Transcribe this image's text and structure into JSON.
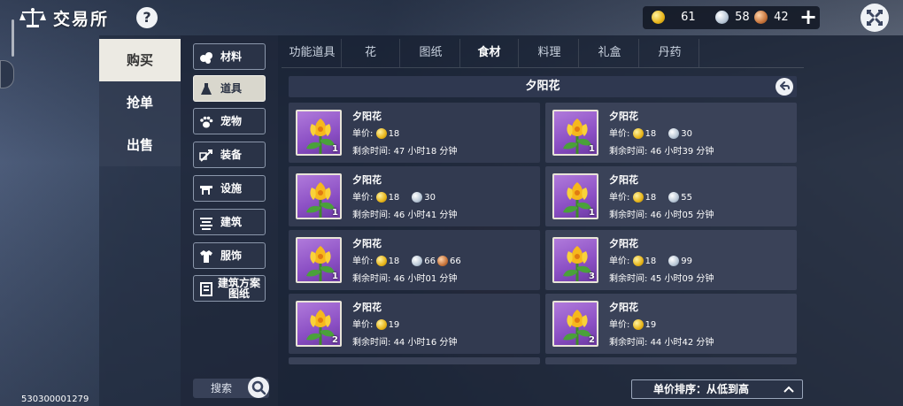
{
  "header": {
    "title": "交易所",
    "help_label": "?"
  },
  "currency": {
    "gold": "61",
    "silver": "58",
    "bronze": "42",
    "add_label": "+"
  },
  "main_tabs": [
    "购买",
    "抢单",
    "出售"
  ],
  "categories": [
    "材料",
    "道具",
    "宠物",
    "装备",
    "设施",
    "建筑",
    "服饰",
    "建筑方案图纸"
  ],
  "search": {
    "label": "搜索"
  },
  "subtabs": [
    "功能道具",
    "花",
    "图纸",
    "食材",
    "料理",
    "礼盒",
    "丹药"
  ],
  "item_header": "夕阳花",
  "listing_labels": {
    "price": "单价:",
    "time": "剩余时间:"
  },
  "listings": [
    {
      "name": "夕阳花",
      "qty": "1",
      "gold": "18",
      "silver": "",
      "bronze": "",
      "time": "47 小时18 分钟"
    },
    {
      "name": "夕阳花",
      "qty": "1",
      "gold": "18",
      "silver": "30",
      "bronze": "",
      "time": "46 小时39 分钟"
    },
    {
      "name": "夕阳花",
      "qty": "1",
      "gold": "18",
      "silver": "30",
      "bronze": "",
      "time": "46 小时41 分钟"
    },
    {
      "name": "夕阳花",
      "qty": "1",
      "gold": "18",
      "silver": "55",
      "bronze": "",
      "time": "46 小时05 分钟"
    },
    {
      "name": "夕阳花",
      "qty": "1",
      "gold": "18",
      "silver": "66",
      "bronze": "66",
      "time": "46 小时01 分钟"
    },
    {
      "name": "夕阳花",
      "qty": "3",
      "gold": "18",
      "silver": "99",
      "bronze": "",
      "time": "45 小时09 分钟"
    },
    {
      "name": "夕阳花",
      "qty": "2",
      "gold": "19",
      "silver": "",
      "bronze": "",
      "time": "44 小时16 分钟"
    },
    {
      "name": "夕阳花",
      "qty": "2",
      "gold": "19",
      "silver": "",
      "bronze": "",
      "time": "44 小时42 分钟"
    }
  ],
  "sort": {
    "label": "单价排序：从低到高"
  },
  "uid": "530300001279",
  "colors": {
    "gold": "#e7b51a",
    "silver": "#b9c7d6",
    "bronze": "#c8753c",
    "panel": "#3a4258"
  }
}
